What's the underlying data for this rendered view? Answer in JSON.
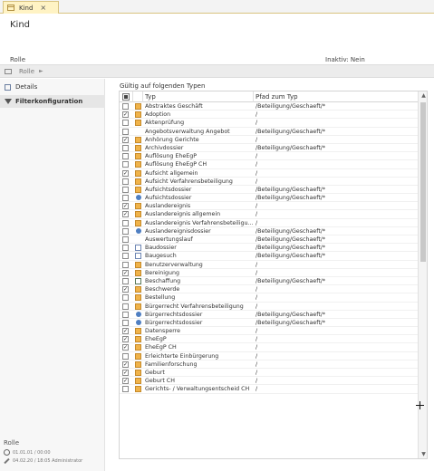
{
  "tab": {
    "label": "Kind",
    "close": "×"
  },
  "header": {
    "title": "Kind",
    "rolle_label": "Rolle",
    "inaktiv": "Inaktiv: Nein"
  },
  "breadcrumb": {
    "text": "Rolle",
    "arrow": "►"
  },
  "sidebar": {
    "items": [
      {
        "label": "Details"
      },
      {
        "label": "Filterkonfiguration"
      }
    ],
    "footer": {
      "title": "Rolle",
      "created": "01.01.01 / 00:00",
      "modified": "04.02.20 / 18:05 Administrator"
    }
  },
  "main": {
    "label": "Gültig auf folgenden Typen",
    "columns": {
      "typ": "Typ",
      "pfad": "Pfad zum Typ"
    },
    "rows": [
      {
        "checked": false,
        "icon": "folder-icon",
        "typ": "Abstraktes Geschäft",
        "pfad": "/Beteiligung/Geschaeft/*"
      },
      {
        "checked": true,
        "icon": "folder-icon",
        "typ": "Adoption",
        "pfad": "/"
      },
      {
        "checked": false,
        "icon": "folder-icon",
        "typ": "Aktenprüfung",
        "pfad": "/"
      },
      {
        "checked": false,
        "icon": "",
        "typ": "Angebotsverwaltung Angebot",
        "pfad": "/Beteiligung/Geschaeft/*"
      },
      {
        "checked": true,
        "icon": "folder-icon",
        "typ": "Anhörung Gerichte",
        "pfad": "/"
      },
      {
        "checked": false,
        "icon": "folder-icon",
        "typ": "Archivdossier",
        "pfad": "/Beteiligung/Geschaeft/*"
      },
      {
        "checked": false,
        "icon": "folder-icon",
        "typ": "Auflösung EheEgP",
        "pfad": "/"
      },
      {
        "checked": false,
        "icon": "folder-icon",
        "typ": "Auflösung EheEgP CH",
        "pfad": "/"
      },
      {
        "checked": true,
        "icon": "folder-icon",
        "typ": "Aufsicht allgemein",
        "pfad": "/"
      },
      {
        "checked": false,
        "icon": "folder-icon",
        "typ": "Aufsicht Verfahrensbeteiligung",
        "pfad": "/"
      },
      {
        "checked": false,
        "icon": "folder-icon",
        "typ": "Aufsichtsdossier",
        "pfad": "/Beteiligung/Geschaeft/*"
      },
      {
        "checked": false,
        "icon": "person-icon",
        "typ": "Aufsichtsdossier",
        "pfad": "/Beteiligung/Geschaeft/*"
      },
      {
        "checked": true,
        "icon": "folder-icon",
        "typ": "Auslandereignis",
        "pfad": "/"
      },
      {
        "checked": true,
        "icon": "folder-icon",
        "typ": "Auslandereignis allgemein",
        "pfad": "/"
      },
      {
        "checked": false,
        "icon": "folder-icon",
        "typ": "Auslandereignis Verfahrensbeteiligu...",
        "pfad": "/"
      },
      {
        "checked": false,
        "icon": "person-icon",
        "typ": "Auslandereignisdossier",
        "pfad": "/Beteiligung/Geschaeft/*"
      },
      {
        "checked": false,
        "icon": "",
        "typ": "Auswertungslauf",
        "pfad": "/Beteiligung/Geschaeft/*"
      },
      {
        "checked": false,
        "icon": "doc-icon",
        "typ": "Baudossier",
        "pfad": "/Beteiligung/Geschaeft/*"
      },
      {
        "checked": false,
        "icon": "doc-icon",
        "typ": "Baugesuch",
        "pfad": "/Beteiligung/Geschaeft/*"
      },
      {
        "checked": false,
        "icon": "folder-icon",
        "typ": "Benutzerverwaltung",
        "pfad": "/"
      },
      {
        "checked": true,
        "icon": "folder-icon",
        "typ": "Bereinigung",
        "pfad": "/"
      },
      {
        "checked": false,
        "icon": "chart-icon",
        "typ": "Beschaffung",
        "pfad": "/Beteiligung/Geschaeft/*"
      },
      {
        "checked": true,
        "icon": "folder-icon",
        "typ": "Beschwerde",
        "pfad": "/"
      },
      {
        "checked": false,
        "icon": "folder-icon",
        "typ": "Bestellung",
        "pfad": "/"
      },
      {
        "checked": false,
        "icon": "folder-icon",
        "typ": "Bürgerrecht Verfahrensbeteiligung",
        "pfad": "/"
      },
      {
        "checked": false,
        "icon": "person-icon",
        "typ": "Bürgerrechtsdossier",
        "pfad": "/Beteiligung/Geschaeft/*"
      },
      {
        "checked": false,
        "icon": "person-icon",
        "typ": "Bürgerrechtsdossier",
        "pfad": "/Beteiligung/Geschaeft/*"
      },
      {
        "checked": true,
        "icon": "folder-icon",
        "typ": "Datensperre",
        "pfad": "/"
      },
      {
        "checked": true,
        "icon": "folder-icon",
        "typ": "EheEgP",
        "pfad": "/"
      },
      {
        "checked": true,
        "icon": "folder-icon",
        "typ": "EheEgP CH",
        "pfad": "/"
      },
      {
        "checked": false,
        "icon": "folder-icon",
        "typ": "Erleichterte Einbürgerung",
        "pfad": "/"
      },
      {
        "checked": true,
        "icon": "folder-icon",
        "typ": "Familienforschung",
        "pfad": "/"
      },
      {
        "checked": true,
        "icon": "folder-icon",
        "typ": "Geburt",
        "pfad": "/"
      },
      {
        "checked": true,
        "icon": "folder-icon",
        "typ": "Geburt CH",
        "pfad": "/"
      },
      {
        "checked": false,
        "icon": "folder-icon",
        "typ": "Gerichts- / Verwaltungsentscheid CH",
        "pfad": "/"
      }
    ]
  },
  "scroll": {
    "up": "▲",
    "down": "▼"
  },
  "colors": {
    "tab_bg": "#fff3c4",
    "folder": "#f0b34a",
    "person": "#4f7fc2",
    "accent_border": "#d8c380"
  }
}
